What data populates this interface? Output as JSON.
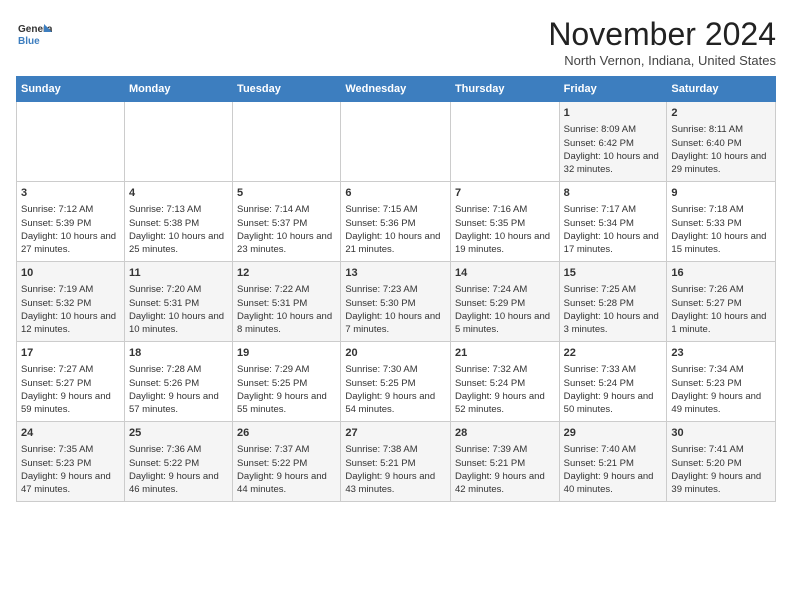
{
  "header": {
    "logo_line1": "General",
    "logo_line2": "Blue",
    "month_title": "November 2024",
    "location": "North Vernon, Indiana, United States"
  },
  "days_of_week": [
    "Sunday",
    "Monday",
    "Tuesday",
    "Wednesday",
    "Thursday",
    "Friday",
    "Saturday"
  ],
  "weeks": [
    [
      {
        "day": "",
        "content": ""
      },
      {
        "day": "",
        "content": ""
      },
      {
        "day": "",
        "content": ""
      },
      {
        "day": "",
        "content": ""
      },
      {
        "day": "",
        "content": ""
      },
      {
        "day": "1",
        "content": "Sunrise: 8:09 AM\nSunset: 6:42 PM\nDaylight: 10 hours and 32 minutes."
      },
      {
        "day": "2",
        "content": "Sunrise: 8:11 AM\nSunset: 6:40 PM\nDaylight: 10 hours and 29 minutes."
      }
    ],
    [
      {
        "day": "3",
        "content": "Sunrise: 7:12 AM\nSunset: 5:39 PM\nDaylight: 10 hours and 27 minutes."
      },
      {
        "day": "4",
        "content": "Sunrise: 7:13 AM\nSunset: 5:38 PM\nDaylight: 10 hours and 25 minutes."
      },
      {
        "day": "5",
        "content": "Sunrise: 7:14 AM\nSunset: 5:37 PM\nDaylight: 10 hours and 23 minutes."
      },
      {
        "day": "6",
        "content": "Sunrise: 7:15 AM\nSunset: 5:36 PM\nDaylight: 10 hours and 21 minutes."
      },
      {
        "day": "7",
        "content": "Sunrise: 7:16 AM\nSunset: 5:35 PM\nDaylight: 10 hours and 19 minutes."
      },
      {
        "day": "8",
        "content": "Sunrise: 7:17 AM\nSunset: 5:34 PM\nDaylight: 10 hours and 17 minutes."
      },
      {
        "day": "9",
        "content": "Sunrise: 7:18 AM\nSunset: 5:33 PM\nDaylight: 10 hours and 15 minutes."
      }
    ],
    [
      {
        "day": "10",
        "content": "Sunrise: 7:19 AM\nSunset: 5:32 PM\nDaylight: 10 hours and 12 minutes."
      },
      {
        "day": "11",
        "content": "Sunrise: 7:20 AM\nSunset: 5:31 PM\nDaylight: 10 hours and 10 minutes."
      },
      {
        "day": "12",
        "content": "Sunrise: 7:22 AM\nSunset: 5:31 PM\nDaylight: 10 hours and 8 minutes."
      },
      {
        "day": "13",
        "content": "Sunrise: 7:23 AM\nSunset: 5:30 PM\nDaylight: 10 hours and 7 minutes."
      },
      {
        "day": "14",
        "content": "Sunrise: 7:24 AM\nSunset: 5:29 PM\nDaylight: 10 hours and 5 minutes."
      },
      {
        "day": "15",
        "content": "Sunrise: 7:25 AM\nSunset: 5:28 PM\nDaylight: 10 hours and 3 minutes."
      },
      {
        "day": "16",
        "content": "Sunrise: 7:26 AM\nSunset: 5:27 PM\nDaylight: 10 hours and 1 minute."
      }
    ],
    [
      {
        "day": "17",
        "content": "Sunrise: 7:27 AM\nSunset: 5:27 PM\nDaylight: 9 hours and 59 minutes."
      },
      {
        "day": "18",
        "content": "Sunrise: 7:28 AM\nSunset: 5:26 PM\nDaylight: 9 hours and 57 minutes."
      },
      {
        "day": "19",
        "content": "Sunrise: 7:29 AM\nSunset: 5:25 PM\nDaylight: 9 hours and 55 minutes."
      },
      {
        "day": "20",
        "content": "Sunrise: 7:30 AM\nSunset: 5:25 PM\nDaylight: 9 hours and 54 minutes."
      },
      {
        "day": "21",
        "content": "Sunrise: 7:32 AM\nSunset: 5:24 PM\nDaylight: 9 hours and 52 minutes."
      },
      {
        "day": "22",
        "content": "Sunrise: 7:33 AM\nSunset: 5:24 PM\nDaylight: 9 hours and 50 minutes."
      },
      {
        "day": "23",
        "content": "Sunrise: 7:34 AM\nSunset: 5:23 PM\nDaylight: 9 hours and 49 minutes."
      }
    ],
    [
      {
        "day": "24",
        "content": "Sunrise: 7:35 AM\nSunset: 5:23 PM\nDaylight: 9 hours and 47 minutes."
      },
      {
        "day": "25",
        "content": "Sunrise: 7:36 AM\nSunset: 5:22 PM\nDaylight: 9 hours and 46 minutes."
      },
      {
        "day": "26",
        "content": "Sunrise: 7:37 AM\nSunset: 5:22 PM\nDaylight: 9 hours and 44 minutes."
      },
      {
        "day": "27",
        "content": "Sunrise: 7:38 AM\nSunset: 5:21 PM\nDaylight: 9 hours and 43 minutes."
      },
      {
        "day": "28",
        "content": "Sunrise: 7:39 AM\nSunset: 5:21 PM\nDaylight: 9 hours and 42 minutes."
      },
      {
        "day": "29",
        "content": "Sunrise: 7:40 AM\nSunset: 5:21 PM\nDaylight: 9 hours and 40 minutes."
      },
      {
        "day": "30",
        "content": "Sunrise: 7:41 AM\nSunset: 5:20 PM\nDaylight: 9 hours and 39 minutes."
      }
    ]
  ]
}
